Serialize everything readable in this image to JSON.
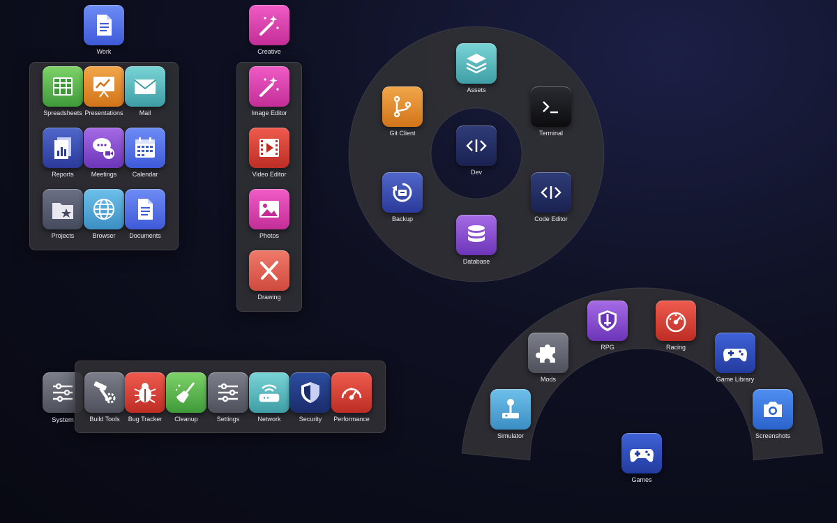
{
  "work": {
    "title": "Work",
    "items": [
      "Spreadsheets",
      "Presentations",
      "Mail",
      "Reports",
      "Meetings",
      "Calendar",
      "Projects",
      "Browser",
      "Documents"
    ]
  },
  "creative": {
    "title": "Creative",
    "items": [
      "Image Editor",
      "Video Editor",
      "Photos",
      "Drawing"
    ]
  },
  "dev": {
    "title": "Dev",
    "items": [
      "Assets",
      "Terminal",
      "Code Editor",
      "Database",
      "Backup",
      "Git Client"
    ]
  },
  "system": {
    "title": "System",
    "items": [
      "Build Tools",
      "Bug Tracker",
      "Cleanup",
      "Settings",
      "Network",
      "Security",
      "Performance"
    ]
  },
  "games": {
    "title": "Games",
    "items": [
      "Simulator",
      "Mods",
      "RPG",
      "Racing",
      "Game Library",
      "Screenshots"
    ]
  },
  "icons": {
    "work": "document-icon",
    "creative": "magic-wand-icon",
    "dev": "code-icon",
    "system": "sliders-icon",
    "games": "gamepad-icon"
  },
  "colors": {
    "panel": "#303034",
    "background": "#0f1124"
  }
}
